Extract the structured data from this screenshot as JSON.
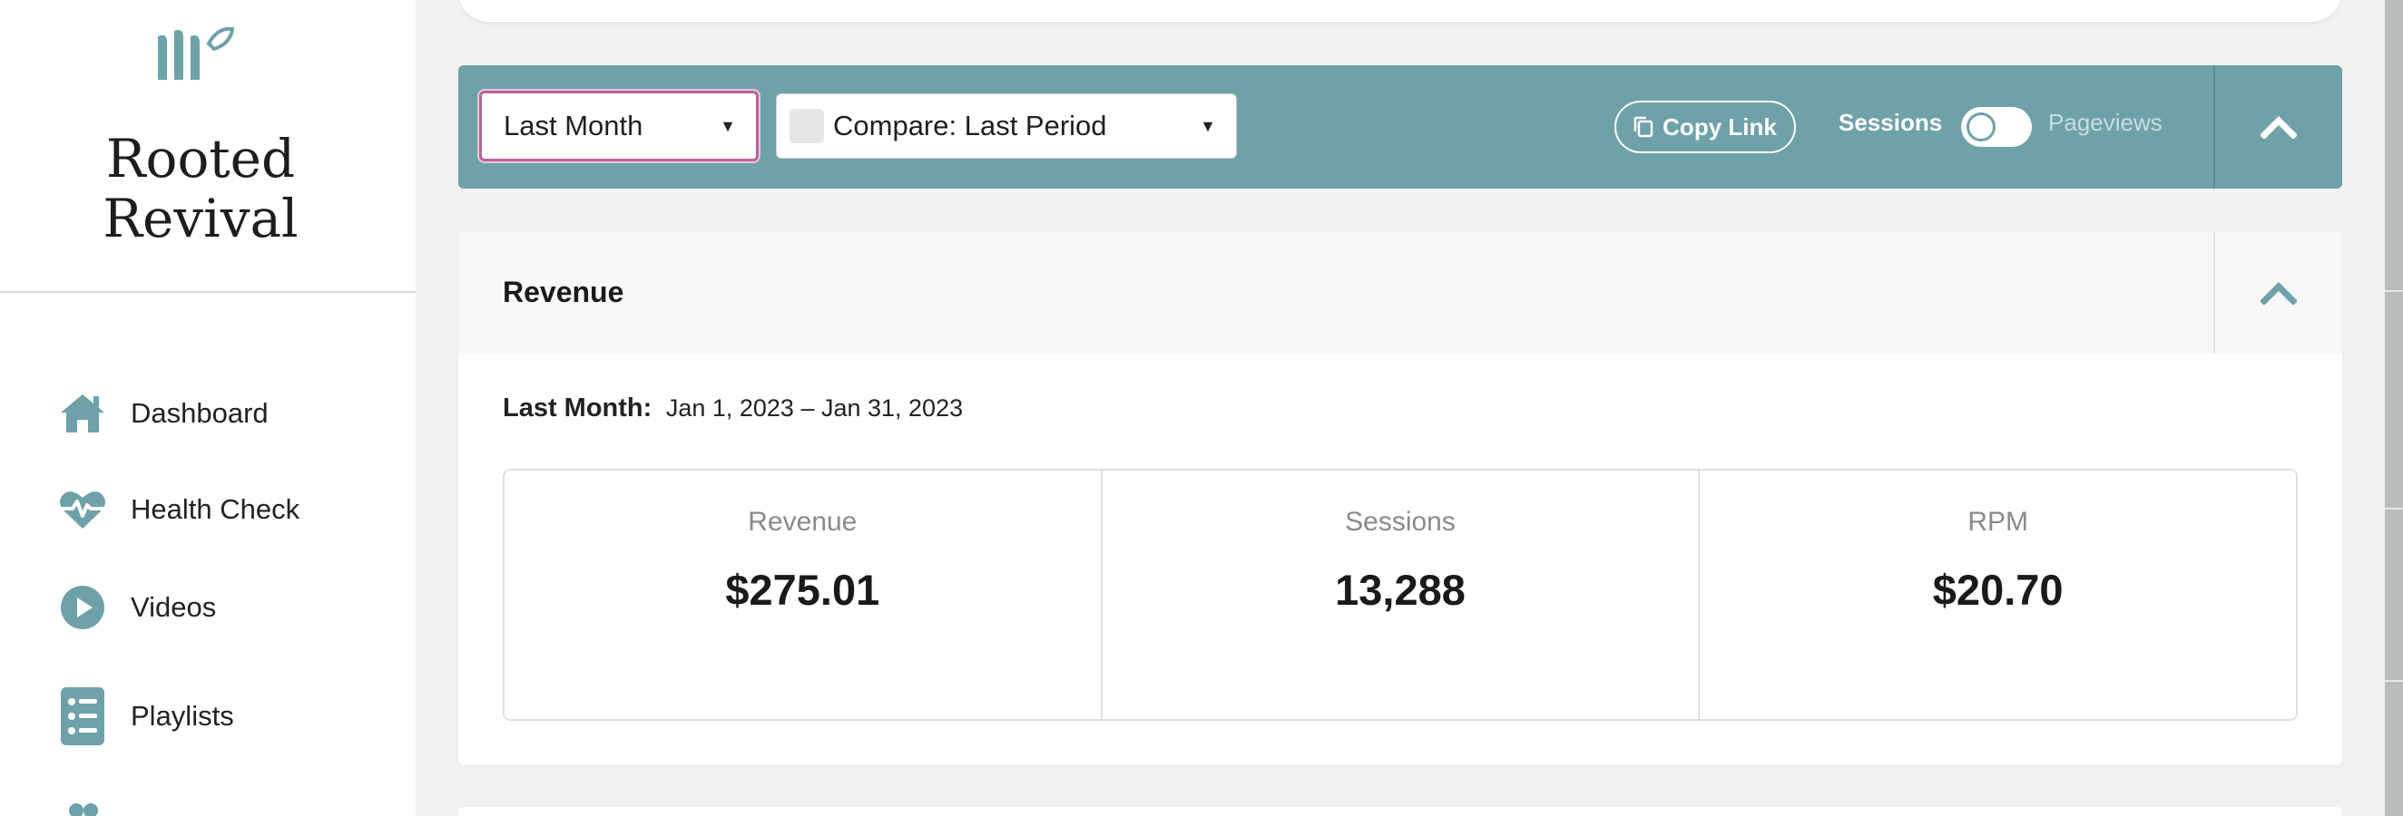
{
  "brand": {
    "line1": "Rooted",
    "line2": "Revival"
  },
  "sidebar": {
    "items": [
      {
        "label": "Dashboard",
        "icon": "home-icon"
      },
      {
        "label": "Health Check",
        "icon": "heart-pulse-icon"
      },
      {
        "label": "Videos",
        "icon": "play-circle-icon"
      },
      {
        "label": "Playlists",
        "icon": "list-icon"
      }
    ]
  },
  "filters": {
    "period_value": "Last Month",
    "compare_value": "Compare: Last Period",
    "copy_link_label": "Copy Link",
    "toggle_left_label": "Sessions",
    "toggle_right_label": "Pageviews",
    "toggle_state": "Sessions"
  },
  "revenue_panel": {
    "title": "Revenue",
    "range_label": "Last Month:",
    "range_value": "Jan 1, 2023 – Jan 31, 2023",
    "stats": [
      {
        "label": "Revenue",
        "value": "$275.01"
      },
      {
        "label": "Sessions",
        "value": "13,288"
      },
      {
        "label": "RPM",
        "value": "$20.70"
      }
    ]
  },
  "colors": {
    "accent": "#6fa1a9",
    "focus_border": "#b8659a",
    "sidebar_bg": "#ffffff",
    "page_bg": "#f1f1f1"
  }
}
